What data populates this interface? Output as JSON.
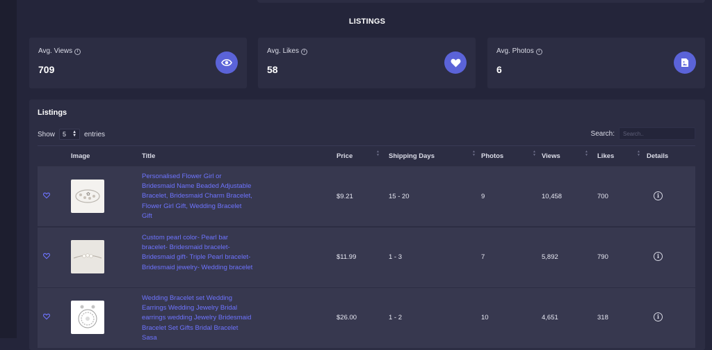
{
  "page": {
    "section_title": "LISTINGS"
  },
  "stats": [
    {
      "label": "Avg. Views",
      "value": "709",
      "icon": "eye-icon"
    },
    {
      "label": "Avg. Likes",
      "value": "58",
      "icon": "heart-icon"
    },
    {
      "label": "Avg. Photos",
      "value": "6",
      "icon": "image-file-icon"
    }
  ],
  "listings": {
    "title": "Listings",
    "show_label": "Show",
    "entries_value": "5",
    "entries_label": "entries",
    "search_label": "Search:",
    "search_placeholder": "Search..",
    "columns": [
      "Image",
      "Title",
      "Price",
      "Shipping Days",
      "Photos",
      "Views",
      "Likes",
      "Details"
    ],
    "rows": [
      {
        "title": "Personalised Flower Girl or Bridesmaid Name Beaded Adjustable Bracelet, Bridesmaid Charm Bracelet, Flower Girl Gift, Wedding Bracelet Gift",
        "price": "$9.21",
        "shipping_days": "15 - 20",
        "photos": "9",
        "views": "10,458",
        "likes": "700"
      },
      {
        "title": "Custom pearl color- Pearl bar bracelet- Bridesmaid bracelet- Bridesmaid gift- Triple Pearl bracelet- Bridesmaid jewelry- Wedding bracelet",
        "price": "$11.99",
        "shipping_days": "1 - 3",
        "photos": "7",
        "views": "5,892",
        "likes": "790"
      },
      {
        "title": "Wedding Bracelet set Wedding Earrings Wedding Jewelry Bridal earrings wedding Jewelry Bridesmaid Bracelet Set Gifts Bridal Bracelet Sasa",
        "price": "$26.00",
        "shipping_days": "1 - 2",
        "photos": "10",
        "views": "4,651",
        "likes": "318"
      }
    ]
  },
  "colors": {
    "accent": "#5b63d8",
    "link": "#6e74ff",
    "background": "#24253a",
    "card": "#2c2d43",
    "row": "#37384f"
  }
}
